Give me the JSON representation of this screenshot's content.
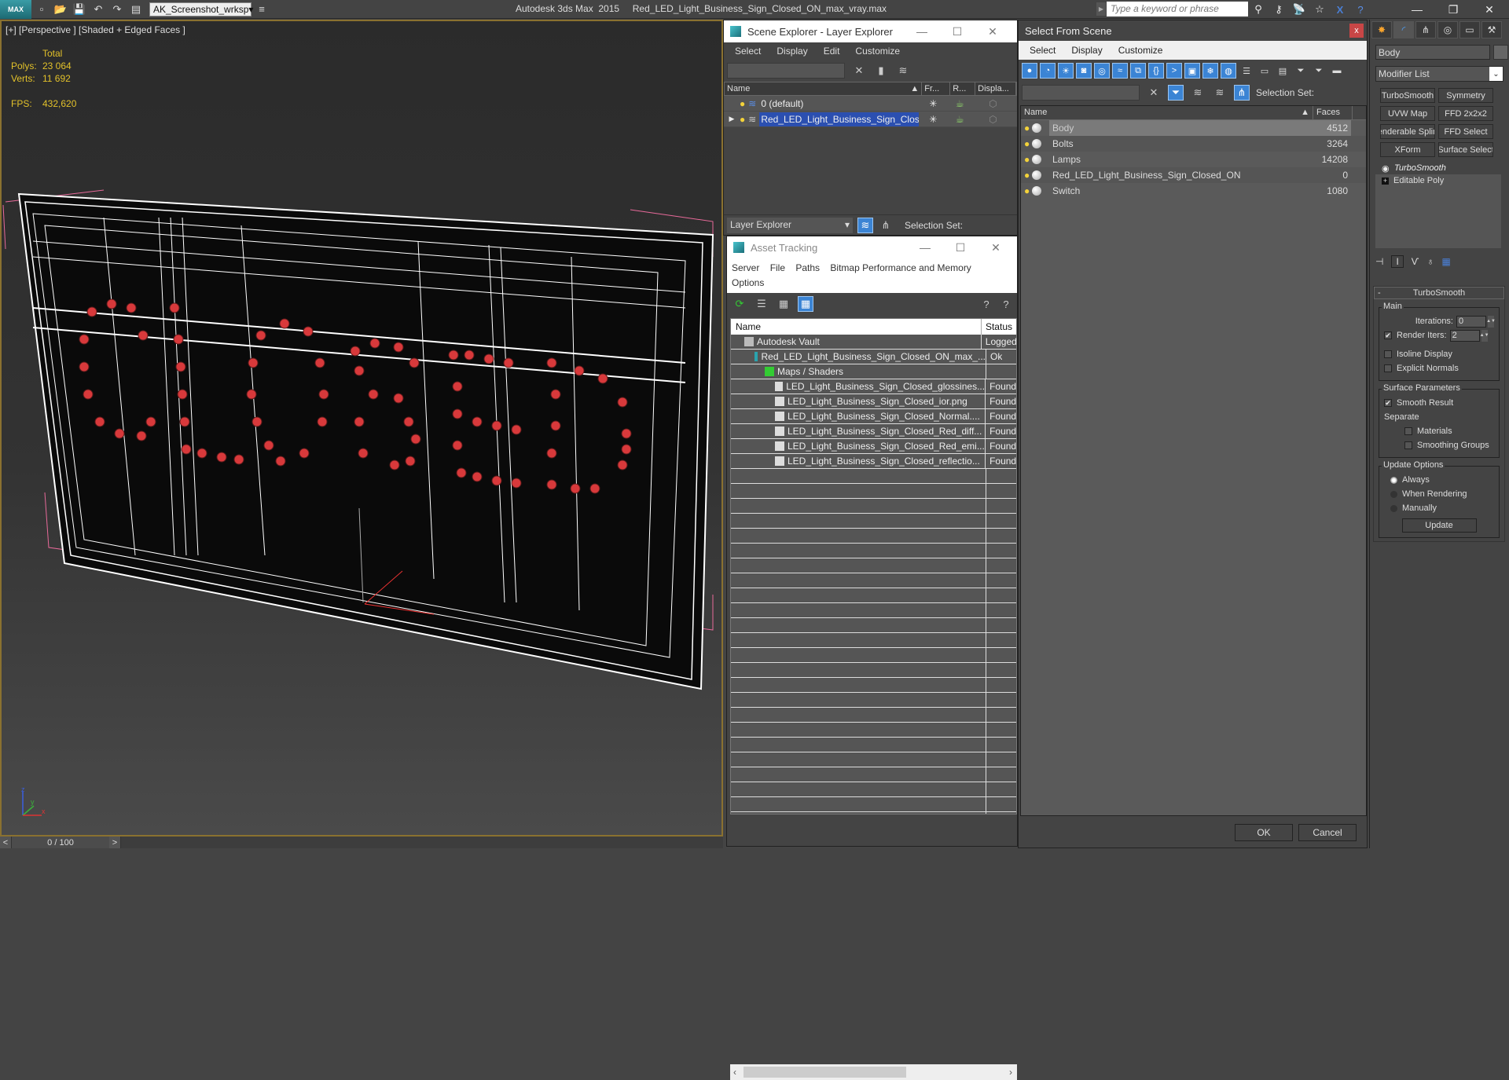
{
  "titlebar": {
    "app_logo": "MAX",
    "workspace": "AK_Screenshot_wrksp",
    "title": "Autodesk 3ds Max  2015     Red_LED_Light_Business_Sign_Closed_ON_max_vray.max",
    "search_placeholder": "Type a keyword or phrase",
    "icons": [
      "new-icon",
      "open-icon",
      "save-icon",
      "undo-icon",
      "redo-icon",
      "project-folder-icon"
    ],
    "right_icons": [
      "binoculars-icon",
      "key-icon",
      "satellite-icon",
      "star-icon",
      "x-icon",
      "help-icon"
    ]
  },
  "viewport": {
    "label": "[+] [Perspective ] [Shaded + Edged Faces ]",
    "stats": {
      "header": "Total",
      "polys_label": "Polys:",
      "polys": "23 064",
      "verts_label": "Verts:",
      "verts": "11 692",
      "fps_label": "FPS:",
      "fps": "432,620"
    },
    "axis": {
      "x": "x",
      "y": "y",
      "z": "z"
    }
  },
  "timeline": {
    "prev": "<",
    "next": ">",
    "frame": "0 / 100"
  },
  "scene_explorer": {
    "title": "Scene Explorer - Layer Explorer",
    "menu": [
      "Select",
      "Display",
      "Edit",
      "Customize"
    ],
    "columns": [
      "Name",
      "Fr...",
      "R...",
      "Displa..."
    ],
    "rows": [
      {
        "name": "0 (default)",
        "selected": false
      },
      {
        "name": "Red_LED_Light_Business_Sign_Close...",
        "selected": true
      }
    ],
    "bottom": {
      "explorer": "Layer Explorer",
      "selection_set": "Selection Set:"
    }
  },
  "asset_tracking": {
    "title": "Asset Tracking",
    "menu": [
      "Server",
      "File",
      "Paths",
      "Bitmap Performance and Memory",
      "Options"
    ],
    "columns": [
      "Name",
      "Status"
    ],
    "rows": [
      {
        "name": "Autodesk Vault",
        "status": "Logged",
        "indent": 1,
        "icon": "vault-icon"
      },
      {
        "name": "Red_LED_Light_Business_Sign_Closed_ON_max_...",
        "status": "Ok",
        "indent": 2,
        "icon": "max-file-icon"
      },
      {
        "name": "Maps / Shaders",
        "status": "",
        "indent": 3,
        "icon": "maps-icon"
      },
      {
        "name": "LED_Light_Business_Sign_Closed_glossines...",
        "status": "Found",
        "indent": 4,
        "icon": "bitmap-icon"
      },
      {
        "name": "LED_Light_Business_Sign_Closed_ior.png",
        "status": "Found",
        "indent": 4,
        "icon": "bitmap-icon"
      },
      {
        "name": "LED_Light_Business_Sign_Closed_Normal....",
        "status": "Found",
        "indent": 4,
        "icon": "bitmap-icon"
      },
      {
        "name": "LED_Light_Business_Sign_Closed_Red_diff...",
        "status": "Found",
        "indent": 4,
        "icon": "bitmap-icon"
      },
      {
        "name": "LED_Light_Business_Sign_Closed_Red_emi...",
        "status": "Found",
        "indent": 4,
        "icon": "bitmap-icon"
      },
      {
        "name": "LED_Light_Business_Sign_Closed_reflectio...",
        "status": "Found",
        "indent": 4,
        "icon": "bitmap-icon"
      }
    ]
  },
  "select_from_scene": {
    "title": "Select From Scene",
    "close": "x",
    "menu": [
      "Select",
      "Display",
      "Customize"
    ],
    "selection_set": "Selection Set:",
    "columns": [
      "Name",
      "Faces"
    ],
    "rows": [
      {
        "name": "Body",
        "faces": "4512",
        "selected": true
      },
      {
        "name": "Bolts",
        "faces": "3264",
        "selected": false
      },
      {
        "name": "Lamps",
        "faces": "14208",
        "selected": false
      },
      {
        "name": "Red_LED_Light_Business_Sign_Closed_ON",
        "faces": "0",
        "selected": false
      },
      {
        "name": "Switch",
        "faces": "1080",
        "selected": false
      }
    ],
    "ok": "OK",
    "cancel": "Cancel"
  },
  "command_panel": {
    "object_name": "Body",
    "modifier_list": "Modifier List",
    "modifier_buttons": [
      "TurboSmooth",
      "Symmetry",
      "UVW Map",
      "FFD 2x2x2",
      "enderable Splin",
      "FFD Select",
      "XForm",
      "Surface Select"
    ],
    "stack": [
      "TurboSmooth",
      "Editable Poly"
    ],
    "rollout": {
      "title": "TurboSmooth",
      "main_label": "Main",
      "iterations_label": "Iterations:",
      "iterations": "0",
      "render_iters_label": "Render Iters:",
      "render_iters": "2",
      "render_iters_checked": true,
      "isoline_display": "Isoline Display",
      "explicit_normals": "Explicit Normals",
      "surface_params": "Surface Parameters",
      "smooth_result": "Smooth Result",
      "separate": "Separate",
      "materials": "Materials",
      "smoothing_groups": "Smoothing Groups",
      "update_options": "Update Options",
      "always": "Always",
      "when_rendering": "When Rendering",
      "manually": "Manually",
      "update": "Update",
      "selected_update_option": "Always"
    }
  }
}
